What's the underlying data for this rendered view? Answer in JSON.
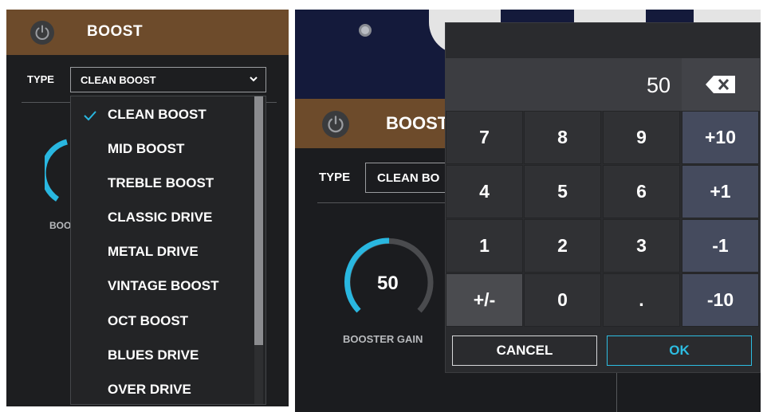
{
  "left": {
    "title": "BOOST",
    "type_label": "TYPE",
    "type_value": "CLEAN BOOST",
    "knob_label_fragment": "BOO",
    "menu": {
      "selected_index": 0,
      "items": [
        "CLEAN BOOST",
        "MID BOOST",
        "TREBLE BOOST",
        "CLASSIC DRIVE",
        "METAL DRIVE",
        "VINTAGE BOOST",
        "OCT BOOST",
        "BLUES DRIVE",
        "OVER DRIVE"
      ]
    }
  },
  "right": {
    "title": "BOOST",
    "type_label": "TYPE",
    "type_value": "CLEAN BO",
    "knob_value": "50",
    "knob_label": "BOOSTER GAIN",
    "keypad": {
      "display_value": "50",
      "keys": {
        "k7": "7",
        "k8": "8",
        "k9": "9",
        "plus10": "+10",
        "k4": "4",
        "k5": "5",
        "k6": "6",
        "plus1": "+1",
        "k1": "1",
        "k2": "2",
        "k3": "3",
        "minus1": "-1",
        "sign": "+/-",
        "k0": "0",
        "dot": ".",
        "minus10": "-10"
      },
      "cancel_label": "CANCEL",
      "ok_label": "OK"
    }
  },
  "colors": {
    "header_brown": "#6d4b2b",
    "panel_bg": "#1d1e20",
    "accent_cyan": "#2dbde2",
    "knob_cyan": "#29b7e0"
  }
}
